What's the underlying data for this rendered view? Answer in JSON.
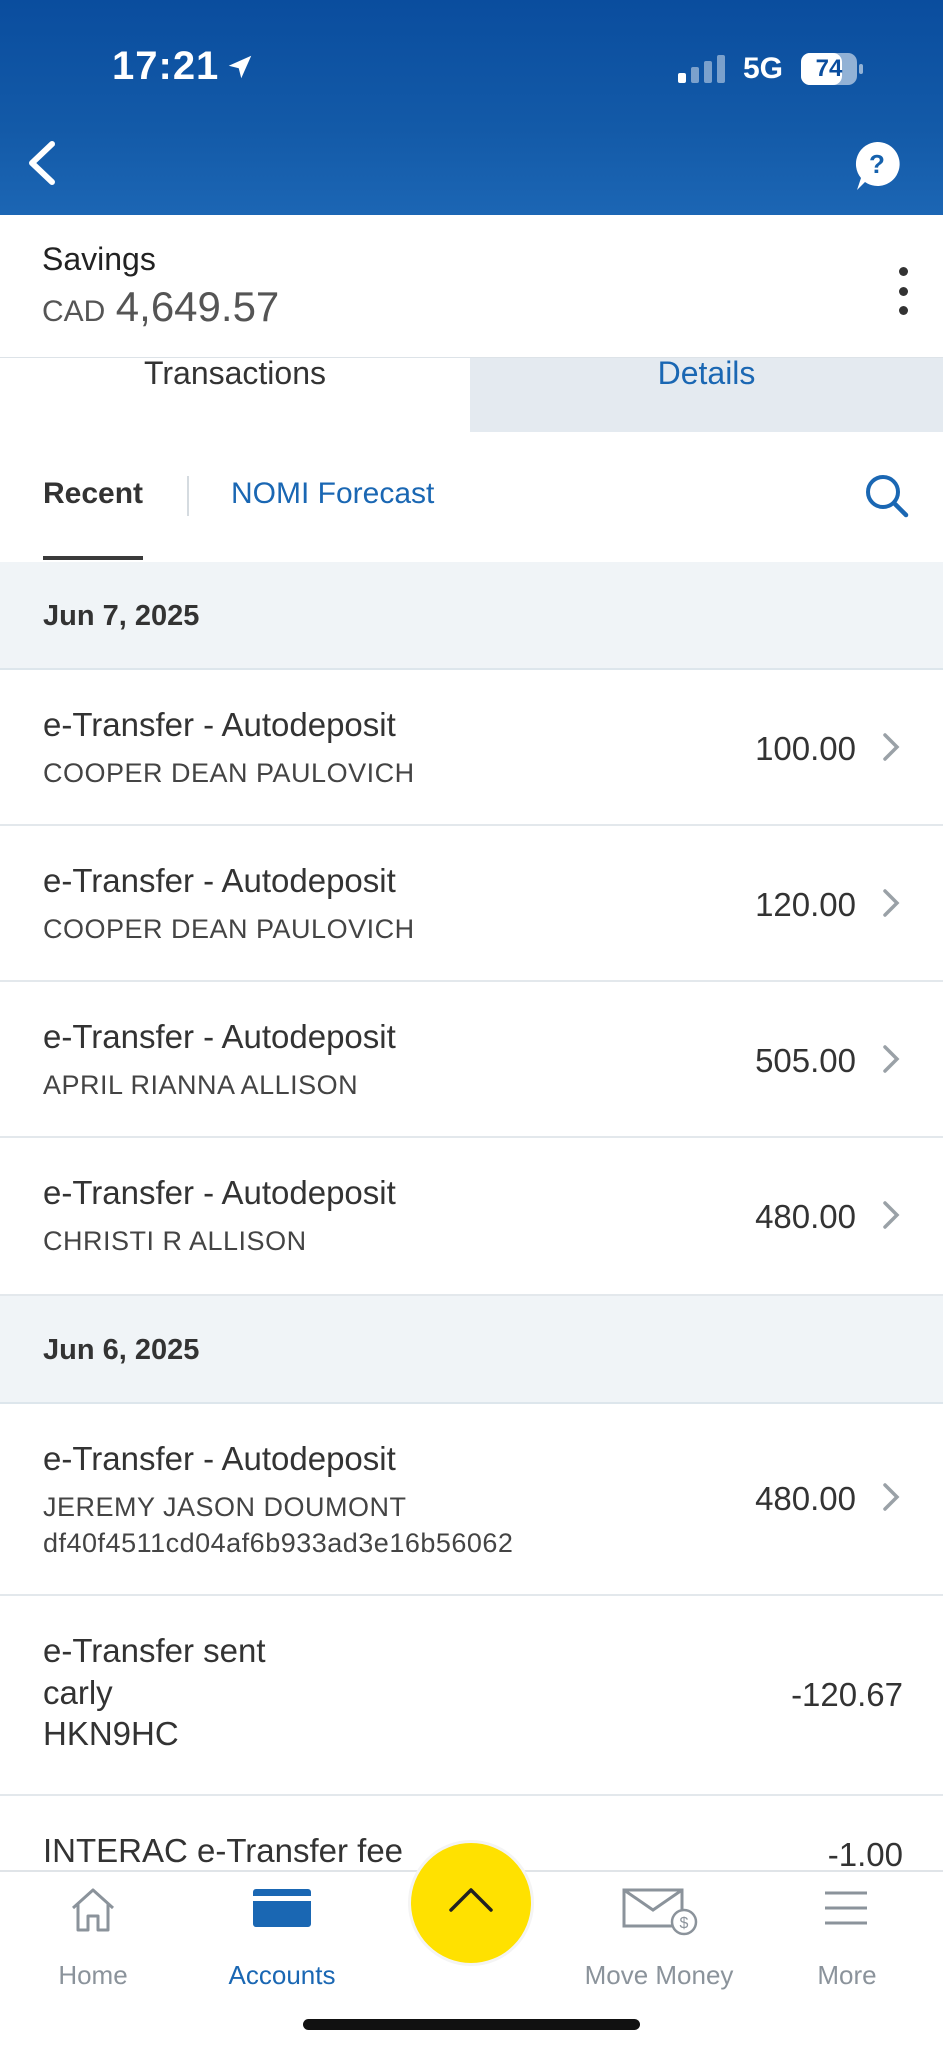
{
  "status_bar": {
    "time": "17:21",
    "network": "5G",
    "battery": "74"
  },
  "account": {
    "name": "Savings",
    "currency": "CAD",
    "balance": "4,649.57"
  },
  "tabs": [
    {
      "label": "Transactions",
      "active": true
    },
    {
      "label": "Details",
      "active": false
    }
  ],
  "subtabs": {
    "recent": "Recent",
    "forecast": "NOMI Forecast"
  },
  "groups": [
    {
      "date": "Jun 7, 2025",
      "transactions": [
        {
          "title": "e-Transfer - Autodeposit",
          "lines": [
            "COOPER DEAN PAULOVICH"
          ],
          "amount": "100.00"
        },
        {
          "title": "e-Transfer - Autodeposit",
          "lines": [
            "COOPER DEAN PAULOVICH"
          ],
          "amount": "120.00"
        },
        {
          "title": "e-Transfer - Autodeposit",
          "lines": [
            "APRIL RIANNA ALLISON"
          ],
          "amount": "505.00"
        },
        {
          "title": "e-Transfer - Autodeposit",
          "lines": [
            "CHRISTI R ALLISON"
          ],
          "amount": "480.00"
        }
      ]
    },
    {
      "date": "Jun 6, 2025",
      "transactions": [
        {
          "title": "e-Transfer - Autodeposit",
          "lines": [
            "JEREMY JASON DOUMONT",
            "df40f4511cd04af6b933ad3e16b56062"
          ],
          "amount": "480.00"
        },
        {
          "title": "e-Transfer sent",
          "lines": [
            "carly",
            "HKN9HC"
          ],
          "amount": "-120.67"
        },
        {
          "title": "INTERAC e-Transfer fee",
          "lines": [],
          "amount": "-1.00"
        }
      ]
    }
  ],
  "nav": {
    "items": [
      {
        "label": "Home",
        "icon": "home-icon"
      },
      {
        "label": "Accounts",
        "icon": "accounts-icon",
        "active": true
      },
      {
        "label": "Move Money",
        "icon": "move-money-icon"
      },
      {
        "label": "More",
        "icon": "menu-icon"
      }
    ],
    "fab_icon": "chevron-up-icon"
  },
  "colors": {
    "header_blue": "#0a4d9e",
    "link_blue": "#1a67b3",
    "fab_yellow": "#ffe100"
  }
}
